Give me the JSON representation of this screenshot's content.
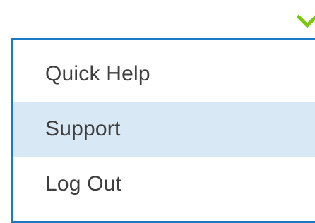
{
  "colors": {
    "chevron": "#7ac70c",
    "border": "#1a7ac6",
    "hover_bg": "#d9e8f5",
    "text": "#3e3e3e"
  },
  "toggle": {
    "icon": "chevron-down-icon"
  },
  "menu": {
    "items": [
      {
        "label": "Quick Help",
        "highlighted": false
      },
      {
        "label": "Support",
        "highlighted": true
      },
      {
        "label": "Log Out",
        "highlighted": false
      }
    ]
  }
}
